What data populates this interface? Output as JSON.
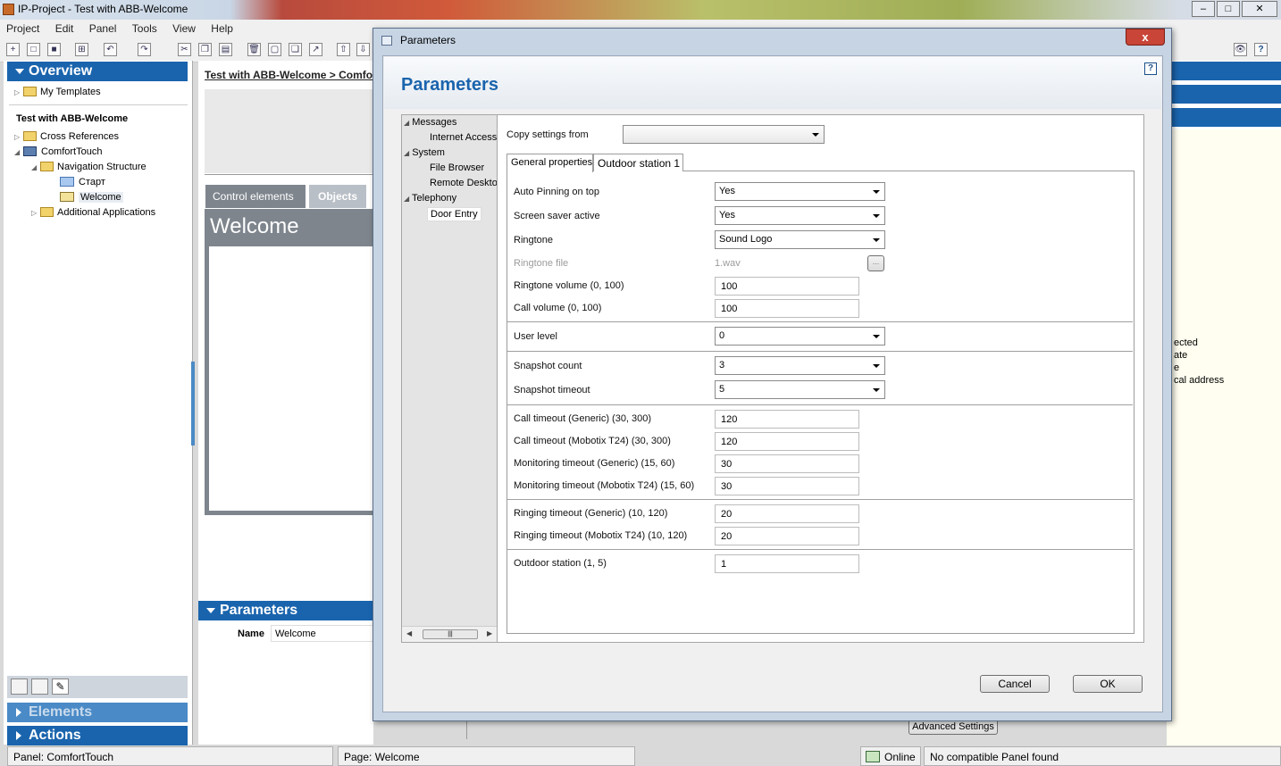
{
  "app": {
    "title": "IP-Project - Test with ABB-Welcome"
  },
  "menu": [
    "Project",
    "Edit",
    "Panel",
    "Tools",
    "View",
    "Help"
  ],
  "sidebar": {
    "overview": "Overview",
    "my_templates": "My Templates",
    "project_name": "Test with ABB-Welcome",
    "cross_references": "Cross References",
    "comforttouch": "ComfortTouch",
    "navigation_structure": "Navigation Structure",
    "page_start": "Старт",
    "page_welcome": "Welcome",
    "additional_applications": "Additional Applications",
    "elements": "Elements",
    "actions": "Actions"
  },
  "center": {
    "breadcrumb": "Test with ABB-Welcome > Comfo",
    "tab_control": "Control elements",
    "tab_objects": "Objects",
    "page_title": "Welcome",
    "parameters_header": "Parameters",
    "name_label": "Name",
    "name_value": "Welcome",
    "advanced_button": "Advanced Settings"
  },
  "right_panel": {
    "line1": "ected",
    "line2": "ate",
    "line3": "e",
    "line4": "cal address"
  },
  "dialog": {
    "title": "Parameters",
    "heading": "Parameters",
    "help": "?",
    "close": "x",
    "nav": {
      "messages": "Messages",
      "internet_access": "Internet Access",
      "system": "System",
      "file_browser": "File Browser",
      "remote_desktop": "Remote Desktop",
      "telephony": "Telephony",
      "door_entry": "Door Entry"
    },
    "copy_settings_label": "Copy settings from",
    "copy_settings_value": "",
    "tab_general": "General properties",
    "tab_outdoor": "Outdoor station 1",
    "fields": {
      "auto_pinning_label": "Auto Pinning on top",
      "auto_pinning_value": "Yes",
      "screensaver_label": "Screen saver active",
      "screensaver_value": "Yes",
      "ringtone_label": "Ringtone",
      "ringtone_value": "Sound Logo",
      "ringtone_file_label": "Ringtone file",
      "ringtone_file_value": "1.wav",
      "browse": "...",
      "ringtone_volume_label": "Ringtone volume (0, 100)",
      "ringtone_volume_value": "100",
      "call_volume_label": "Call volume (0, 100)",
      "call_volume_value": "100",
      "user_level_label": "User level",
      "user_level_value": "0",
      "snapshot_count_label": "Snapshot count",
      "snapshot_count_value": "3",
      "snapshot_timeout_label": "Snapshot timeout",
      "snapshot_timeout_value": "5",
      "call_timeout_generic_label": "Call timeout (Generic) (30, 300)",
      "call_timeout_generic_value": "120",
      "call_timeout_mobotix_label": "Call timeout (Mobotix T24) (30, 300)",
      "call_timeout_mobotix_value": "120",
      "monitoring_generic_label": "Monitoring timeout (Generic) (15, 60)",
      "monitoring_generic_value": "30",
      "monitoring_mobotix_label": "Monitoring timeout (Mobotix T24) (15, 60)",
      "monitoring_mobotix_value": "30",
      "ringing_generic_label": "Ringing timeout (Generic) (10, 120)",
      "ringing_generic_value": "20",
      "ringing_mobotix_label": "Ringing timeout (Mobotix T24) (10, 120)",
      "ringing_mobotix_value": "20",
      "outdoor_station_label": "Outdoor station (1, 5)",
      "outdoor_station_value": "1"
    },
    "cancel": "Cancel",
    "ok": "OK"
  },
  "statusbar": {
    "panel": "Panel: ComfortTouch",
    "page": "Page: Welcome",
    "online": "Online",
    "message": "No compatible Panel found"
  }
}
